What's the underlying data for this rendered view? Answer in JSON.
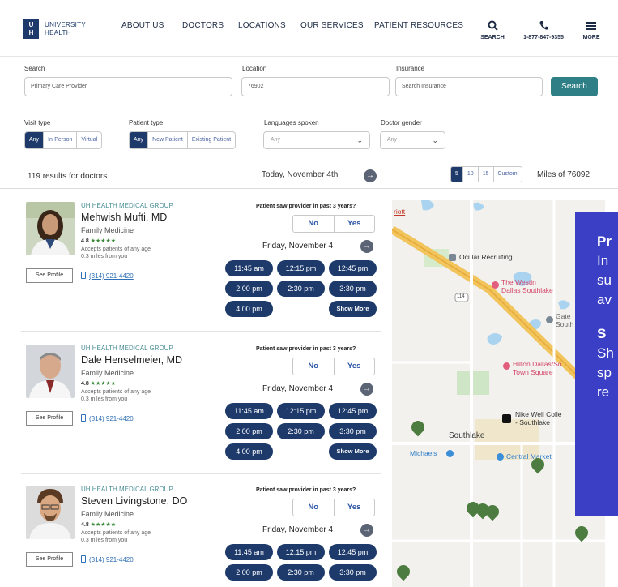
{
  "header": {
    "logo_text_1": "UNIVERSITY",
    "logo_text_2": "HEALTH",
    "logo_mark_1": "U",
    "logo_mark_2": "H",
    "nav": [
      "ABOUT US",
      "DOCTORS",
      "LOCATIONS",
      "OUR SERVICES",
      "PATIENT RESOURCES"
    ],
    "search_label": "SEARCH",
    "phone_label": "1-877-847-9355",
    "more_label": "MORE"
  },
  "search": {
    "search_label": "Search",
    "search_value": "Primary Care Provider",
    "location_label": "Location",
    "location_value": "76902",
    "insurance_label": "Insurance",
    "insurance_placeholder": "Search Insurance",
    "button": "Search"
  },
  "filters": {
    "visit_type_label": "Visit type",
    "visit_type_options": [
      "Any",
      "In-Person",
      "Virtual"
    ],
    "patient_type_label": "Patient type",
    "patient_type_options": [
      "Any",
      "New Patient",
      "Existing Patient"
    ],
    "languages_label": "Languages spoken",
    "languages_value": "Any",
    "gender_label": "Doctor gender",
    "gender_value": "Any"
  },
  "results": {
    "count_text": "119 results for doctors",
    "date_text": "Today, November 4th",
    "miles_options": [
      "5",
      "10",
      "15",
      "Custom"
    ],
    "miles_of": "Miles of 76092"
  },
  "doctors": [
    {
      "group": "UH HEALTH MEDICAL GROUP",
      "name": "Mehwish Mufti, MD",
      "specialty": "Family Medicine",
      "rating": "4.8",
      "stars": "★★★★★",
      "accepts": "Accepts patients of any age",
      "distance": "0.3 miles from you",
      "profile_button": "See Profile",
      "phone": "(314) 921-4420",
      "question": "Patient saw provider in past 3 years?",
      "no": "No",
      "yes": "Yes",
      "slot_date": "Friday, November 4",
      "slots": [
        "11:45 am",
        "12:15 pm",
        "12:45 pm",
        "2:00 pm",
        "2:30 pm",
        "3:30 pm",
        "4:00 pm",
        "Show More"
      ]
    },
    {
      "group": "UH HEALTH MEDICAL GROUP",
      "name": "Dale Henselmeier, MD",
      "specialty": "Family Medicine",
      "rating": "4.8",
      "stars": "★★★★★",
      "accepts": "Accepts patients of any age",
      "distance": "0.3 miles from you",
      "profile_button": "See Profile",
      "phone": "(314) 921-4420",
      "question": "Patient saw provider in past 3 years?",
      "no": "No",
      "yes": "Yes",
      "slot_date": "Friday, November 4",
      "slots": [
        "11:45 am",
        "12:15 pm",
        "12:45 pm",
        "2:00 pm",
        "2:30 pm",
        "3:30 pm",
        "4:00 pm",
        "Show More"
      ]
    },
    {
      "group": "UH HEALTH MEDICAL GROUP",
      "name": "Steven Livingstone, DO",
      "specialty": "Family Medicine",
      "rating": "4.8",
      "stars": "★★★★★",
      "accepts": "Accepts patients of any age",
      "distance": "0.3 miles from you",
      "profile_button": "See Profile",
      "phone": "(314) 921-4420",
      "question": "Patient saw provider in past 3 years?",
      "no": "No",
      "yes": "Yes",
      "slot_date": "Friday, November 4",
      "slots": [
        "11:45 am",
        "12:15 pm",
        "12:45 pm",
        "2:00 pm",
        "2:30 pm",
        "3:30 pm"
      ]
    }
  ],
  "map": {
    "labels": {
      "riott": "riott",
      "ocular": "Ocular Recruiting",
      "westin_1": "The Westin",
      "westin_2": "Dallas Southlake",
      "gate_1": "Gate",
      "gate_2": "South",
      "hilton_1": "Hilton Dallas/So",
      "hilton_2": "Town Square",
      "nike_1": "Nike Well Colle",
      "nike_2": "- Southlake",
      "southlake": "Southlake",
      "michaels": "Michaels",
      "central": "Central Market",
      "route": "114"
    }
  },
  "promo": {
    "line1": "Pr",
    "line2": "In",
    "line3": "su",
    "line4": "av",
    "line5": "S",
    "line6": "Sh",
    "line7": "sp",
    "line8": "re"
  },
  "colors": {
    "brand": "#1d3a6b",
    "teal": "#2f7f86",
    "promo": "#3a3fc5",
    "pin": "#4c7c3f"
  }
}
